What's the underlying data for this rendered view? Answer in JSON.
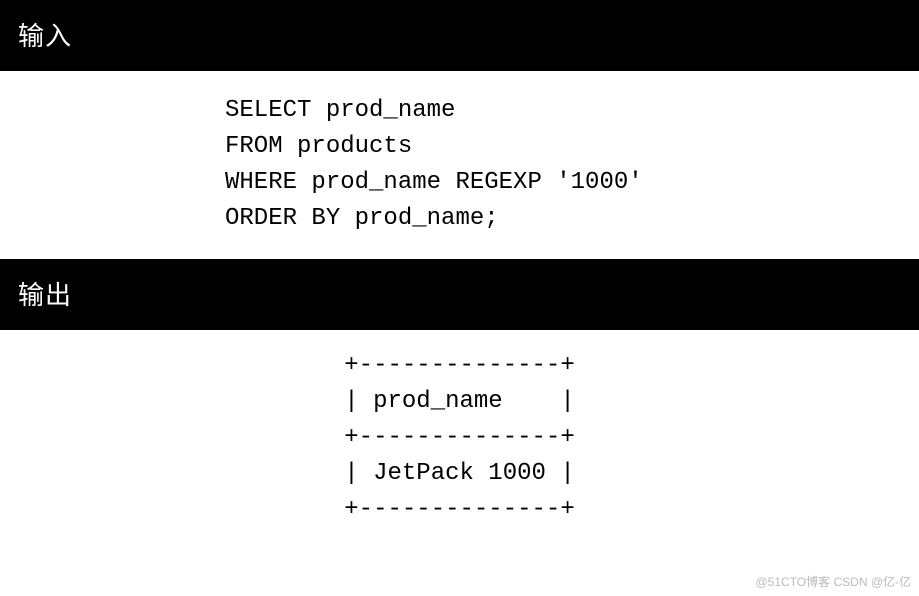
{
  "headers": {
    "input": "输入",
    "output": "输出"
  },
  "code": {
    "line1": "SELECT prod_name",
    "line2": "FROM products",
    "line3": "WHERE prod_name REGEXP '1000'",
    "line4": "ORDER BY prod_name;"
  },
  "result": {
    "border_top": "+--------------+",
    "header_row": "| prod_name    |",
    "border_mid": "+--------------+",
    "data_row": "| JetPack 1000 |",
    "border_bot": "+--------------+"
  },
  "watermark": "@51CTO博客  CSDN @亿-亿"
}
